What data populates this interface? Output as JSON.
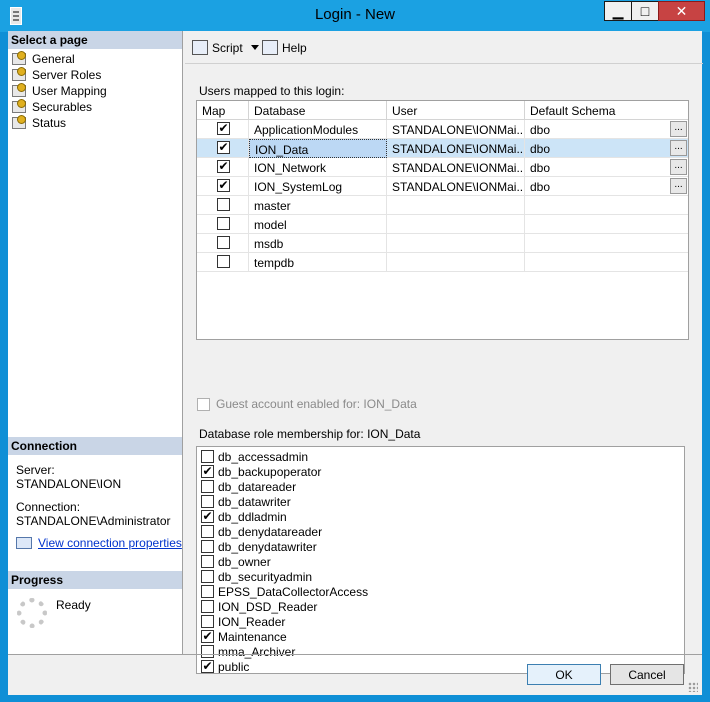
{
  "window": {
    "title": "Login - New"
  },
  "left": {
    "select_page_header": "Select a page",
    "pages": [
      {
        "label": "General",
        "selected": false
      },
      {
        "label": "Server Roles",
        "selected": false
      },
      {
        "label": "User Mapping",
        "selected": true
      },
      {
        "label": "Securables",
        "selected": false
      },
      {
        "label": "Status",
        "selected": false
      }
    ],
    "connection_header": "Connection",
    "server_label": "Server:",
    "server_value": "STANDALONE\\ION",
    "connection_label": "Connection:",
    "connection_value": "STANDALONE\\Administrator",
    "view_conn_link": "View connection properties",
    "progress_header": "Progress",
    "progress_status": "Ready"
  },
  "toolbar": {
    "script_label": "Script",
    "help_label": "Help"
  },
  "users": {
    "section_label": "Users mapped to this login:",
    "columns": [
      "Map",
      "Database",
      "User",
      "Default Schema"
    ],
    "rows": [
      {
        "mapped": true,
        "database": "ApplicationModules",
        "user": "STANDALONE\\IONMai...",
        "schema": "dbo",
        "selected": false
      },
      {
        "mapped": true,
        "database": "ION_Data",
        "user": "STANDALONE\\IONMai...",
        "schema": "dbo",
        "selected": true
      },
      {
        "mapped": true,
        "database": "ION_Network",
        "user": "STANDALONE\\IONMai...",
        "schema": "dbo",
        "selected": false
      },
      {
        "mapped": true,
        "database": "ION_SystemLog",
        "user": "STANDALONE\\IONMai...",
        "schema": "dbo",
        "selected": false
      },
      {
        "mapped": false,
        "database": "master",
        "user": "",
        "schema": "",
        "selected": false
      },
      {
        "mapped": false,
        "database": "model",
        "user": "",
        "schema": "",
        "selected": false
      },
      {
        "mapped": false,
        "database": "msdb",
        "user": "",
        "schema": "",
        "selected": false
      },
      {
        "mapped": false,
        "database": "tempdb",
        "user": "",
        "schema": "",
        "selected": false
      }
    ],
    "ellipsis": "..."
  },
  "guest": {
    "label": "Guest account enabled for: ION_Data",
    "checked": false
  },
  "roles": {
    "section_label": "Database role membership for: ION_Data",
    "items": [
      {
        "label": "db_accessadmin",
        "checked": false
      },
      {
        "label": "db_backupoperator",
        "checked": true
      },
      {
        "label": "db_datareader",
        "checked": false
      },
      {
        "label": "db_datawriter",
        "checked": false
      },
      {
        "label": "db_ddladmin",
        "checked": true
      },
      {
        "label": "db_denydatareader",
        "checked": false
      },
      {
        "label": "db_denydatawriter",
        "checked": false
      },
      {
        "label": "db_owner",
        "checked": false
      },
      {
        "label": "db_securityadmin",
        "checked": false
      },
      {
        "label": "EPSS_DataCollectorAccess",
        "checked": false
      },
      {
        "label": "ION_DSD_Reader",
        "checked": false
      },
      {
        "label": "ION_Reader",
        "checked": false
      },
      {
        "label": "Maintenance",
        "checked": true
      },
      {
        "label": "mma_Archiver",
        "checked": false
      },
      {
        "label": "public",
        "checked": true
      }
    ]
  },
  "buttons": {
    "ok": "OK",
    "cancel": "Cancel"
  },
  "glyphs": {
    "check": "✔",
    "minimize": "▁",
    "maximize": "□",
    "close": "✕"
  }
}
